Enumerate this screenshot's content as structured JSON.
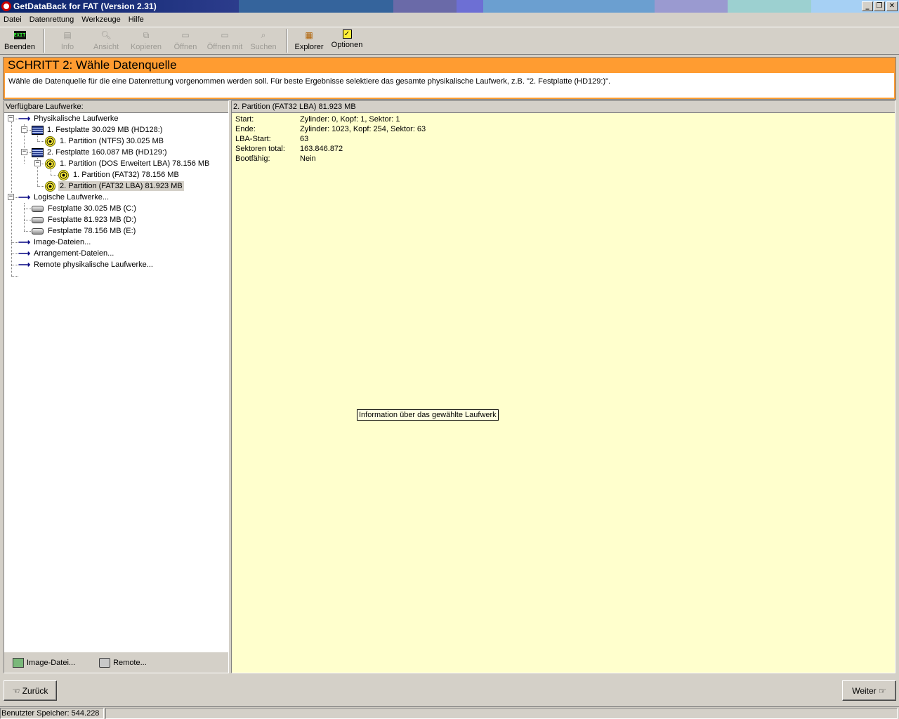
{
  "window": {
    "title": "GetDataBack for FAT (Version 2.31)"
  },
  "menu": [
    "Datei",
    "Datenrettung",
    "Werkzeuge",
    "Hilfe"
  ],
  "toolbar": {
    "beenden": "Beenden",
    "info": "Info",
    "ansicht": "Ansicht",
    "kopieren": "Kopieren",
    "oeffnen": "Öffnen",
    "oeffnen_mit": "Öffnen mit",
    "suchen": "Suchen",
    "explorer": "Explorer",
    "optionen": "Optionen",
    "exit_icon_text": "EXIT"
  },
  "step": {
    "title": "SCHRITT 2: Wähle Datenquelle",
    "description": "Wähle die Datenquelle für die eine Datenrettung vorgenommen werden soll. Für beste Ergebnisse selektiere das gesamte physikalische Laufwerk, z.B. \"2. Festplatte (HD129:)\"."
  },
  "left_panel": {
    "header": "Verfügbare Laufwerke:",
    "tree": {
      "physical": "Physikalische Laufwerke",
      "disk1": "1. Festplatte 30.029 MB (HD128:)",
      "disk1_part1": "1. Partition (NTFS) 30.025 MB",
      "disk2": "2. Festplatte 160.087 MB (HD129:)",
      "disk2_part1": "1. Partition (DOS Erweitert LBA) 78.156 MB",
      "disk2_part1_sub1": "1. Partition (FAT32) 78.156 MB",
      "disk2_part2": "2. Partition (FAT32 LBA) 81.923 MB",
      "logical": "Logische Laufwerke...",
      "drive_c": "Festplatte 30.025 MB (C:)",
      "drive_d": "Festplatte 81.923 MB (D:)",
      "drive_e": "Festplatte 78.156 MB (E:)",
      "image_files": "Image-Dateien...",
      "arrangement_files": "Arrangement-Dateien...",
      "remote_physical": "Remote physikalische Laufwerke..."
    },
    "image_button": "Image-Datei...",
    "remote_button": "Remote..."
  },
  "right_panel": {
    "header": "2. Partition (FAT32 LBA) 81.923 MB",
    "rows": [
      {
        "key": "Start:",
        "value": "Zylinder: 0, Kopf: 1, Sektor: 1"
      },
      {
        "key": "Ende:",
        "value": "Zylinder: 1023, Kopf: 254, Sektor: 63"
      },
      {
        "key": "LBA-Start:",
        "value": "63"
      },
      {
        "key": "Sektoren total:",
        "value": "163.846.872"
      },
      {
        "key": "Bootfähig:",
        "value": "Nein"
      }
    ],
    "tooltip": "Information über das gewählte Laufwerk"
  },
  "nav": {
    "back": "Zurück",
    "next": "Weiter"
  },
  "status": {
    "memory": "Benutzter Speicher: 544.228"
  }
}
